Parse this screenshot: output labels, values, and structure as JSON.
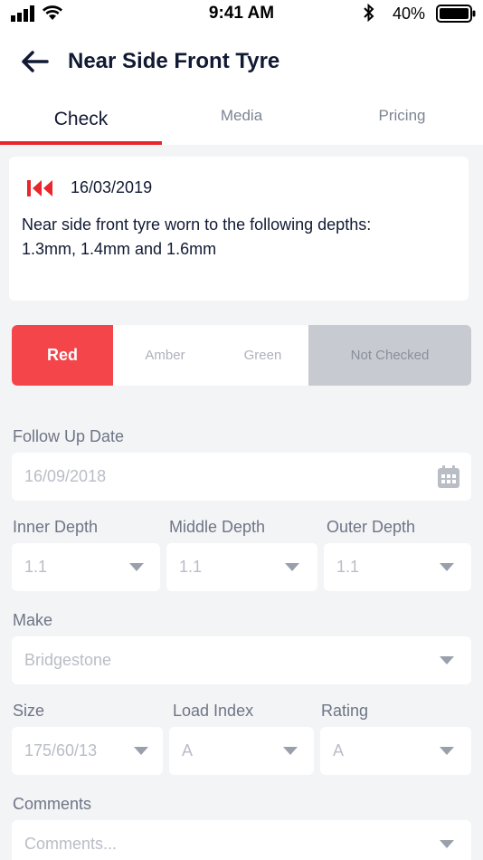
{
  "status_bar": {
    "time": "9:41 AM",
    "battery": "40%",
    "icons": [
      "signal-icon",
      "wifi-icon",
      "bluetooth-icon",
      "battery-icon"
    ]
  },
  "header": {
    "title": "Near Side Front Tyre",
    "back_icon": "arrow-left-icon"
  },
  "tabs": [
    {
      "label": "Check",
      "active": true
    },
    {
      "label": "Media",
      "active": false
    },
    {
      "label": "Pricing",
      "active": false
    }
  ],
  "note": {
    "icon": "rewind-icon",
    "date": "16/03/2019",
    "line1": "Near side front tyre worn to the following depths:",
    "line2": "1.3mm, 1.4mm and 1.6mm"
  },
  "status_selector": {
    "options": [
      "Red",
      "Amber",
      "Green",
      "Not Checked"
    ],
    "selected": "Red",
    "colors": {
      "red": "#f4454a",
      "not_checked": "#c7cad1"
    }
  },
  "follow_up": {
    "label": "Follow Up Date",
    "value": "16/09/2018",
    "icon": "calendar-icon"
  },
  "depths": {
    "inner": {
      "label": "Inner Depth",
      "value": "1.1"
    },
    "middle": {
      "label": "Middle Depth",
      "value": "1.1"
    },
    "outer": {
      "label": "Outer Depth",
      "value": "1.1"
    }
  },
  "make": {
    "label": "Make",
    "value": "Bridgestone"
  },
  "size": {
    "label": "Size",
    "value": "175/60/13"
  },
  "load_index": {
    "label": "Load Index",
    "value": "A"
  },
  "rating": {
    "label": "Rating",
    "value": "A"
  },
  "comments": {
    "label": "Comments",
    "placeholder": "Comments..."
  },
  "accent_color": "#e8262b"
}
